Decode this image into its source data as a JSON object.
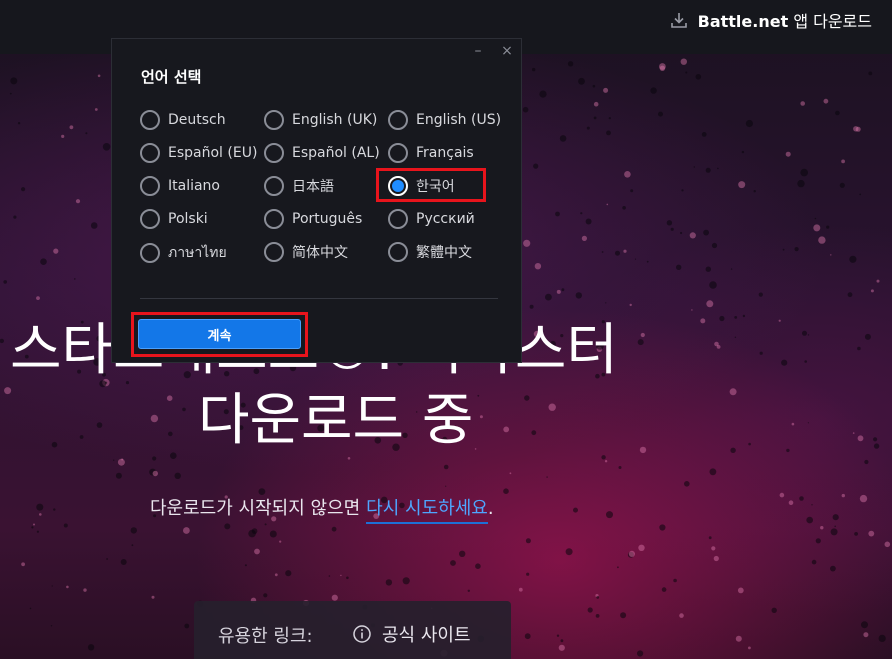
{
  "topbar": {
    "brand": "Battle.net",
    "download_text": "앱 다운로드",
    "icon": "download-icon"
  },
  "hero": {
    "line1": "스타크래프트®: 리마스터",
    "line2": "다운로드 중"
  },
  "retry": {
    "prefix": "다운로드가 시작되지 않으면",
    "link": "다시 시도하세요",
    "suffix": "."
  },
  "links": {
    "label": "유용한 링크:",
    "items": [
      {
        "label": "공식 사이트",
        "icon": "info-icon"
      }
    ]
  },
  "dialog": {
    "title": "언어 선택",
    "minimize": "–",
    "close": "×",
    "languages": [
      {
        "label": "Deutsch",
        "checked": false
      },
      {
        "label": "English (UK)",
        "checked": false
      },
      {
        "label": "English (US)",
        "checked": false
      },
      {
        "label": "Español (EU)",
        "checked": false
      },
      {
        "label": "Español (AL)",
        "checked": false
      },
      {
        "label": "Français",
        "checked": false
      },
      {
        "label": "Italiano",
        "checked": false
      },
      {
        "label": "日本語",
        "checked": false
      },
      {
        "label": "한국어",
        "checked": true
      },
      {
        "label": "Polski",
        "checked": false
      },
      {
        "label": "Português",
        "checked": false
      },
      {
        "label": "Русский",
        "checked": false
      },
      {
        "label": "ภาษาไทย",
        "checked": false
      },
      {
        "label": "简体中文",
        "checked": false
      },
      {
        "label": "繁體中文",
        "checked": false
      }
    ],
    "continue_label": "계속"
  },
  "colors": {
    "accent": "#1377e8",
    "link": "#4ea6ff",
    "highlight": "#e8141c",
    "radio_selected": "#1f8cff"
  }
}
